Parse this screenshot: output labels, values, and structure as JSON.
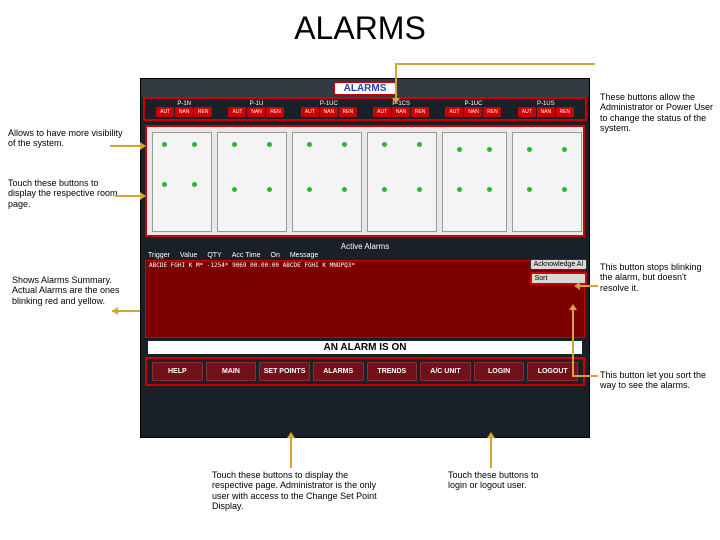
{
  "page_title": "ALARMS",
  "hmi": {
    "header_label": "ALARMS",
    "units": [
      {
        "name": "P-1N",
        "btns": [
          "AUT",
          "NAN",
          "REN"
        ]
      },
      {
        "name": "P-1U",
        "btns": [
          "AUT",
          "NAN",
          "REN"
        ]
      },
      {
        "name": "P-1UC",
        "btns": [
          "AUT",
          "NAN",
          "REN"
        ]
      },
      {
        "name": "P-1CS",
        "btns": [
          "AUT",
          "NAN",
          "REN"
        ]
      },
      {
        "name": "P-1UC",
        "btns": [
          "AUT",
          "NAN",
          "REN"
        ]
      },
      {
        "name": "P-1US",
        "btns": [
          "AUT",
          "NAN",
          "REN"
        ]
      }
    ],
    "active_alarms": {
      "title": "Active Alarms",
      "columns": [
        "Trigger",
        "Value",
        "QTY",
        "Acc Time",
        "On",
        "Message"
      ],
      "row": "ABCDE FGHI K   M*   -1254*  9069  00:00:00     ABCDE FGHI K  MNOPQ3*",
      "ack_label": "Acknowledge Al",
      "sort_label": "Sort"
    },
    "banner": "AN ALARM IS ON",
    "nav": [
      "HELP",
      "MAIN",
      "SET POINTS",
      "ALARMS",
      "TRENDS",
      "A/C UNIT",
      "LOGIN",
      "LOGOUT"
    ]
  },
  "callouts": {
    "left1": "Allows to have more visibility of the system.",
    "left2": "Touch these buttons to display the respective room page.",
    "left3": "Shows Alarms Summary. Actual Alarms are the ones blinking red and yellow.",
    "right1": "These buttons allow the Administrator or Power User to change the status of the system.",
    "right2": "This button stops blinking the alarm, but doesn't resolve it.",
    "right3": "This button let you sort the way to see the alarms.",
    "bottom1": "Touch these buttons to display the respective page. Administrator is the only user with access to the Change Set Point Display.",
    "bottom2": "Touch these buttons to login or logout user."
  }
}
